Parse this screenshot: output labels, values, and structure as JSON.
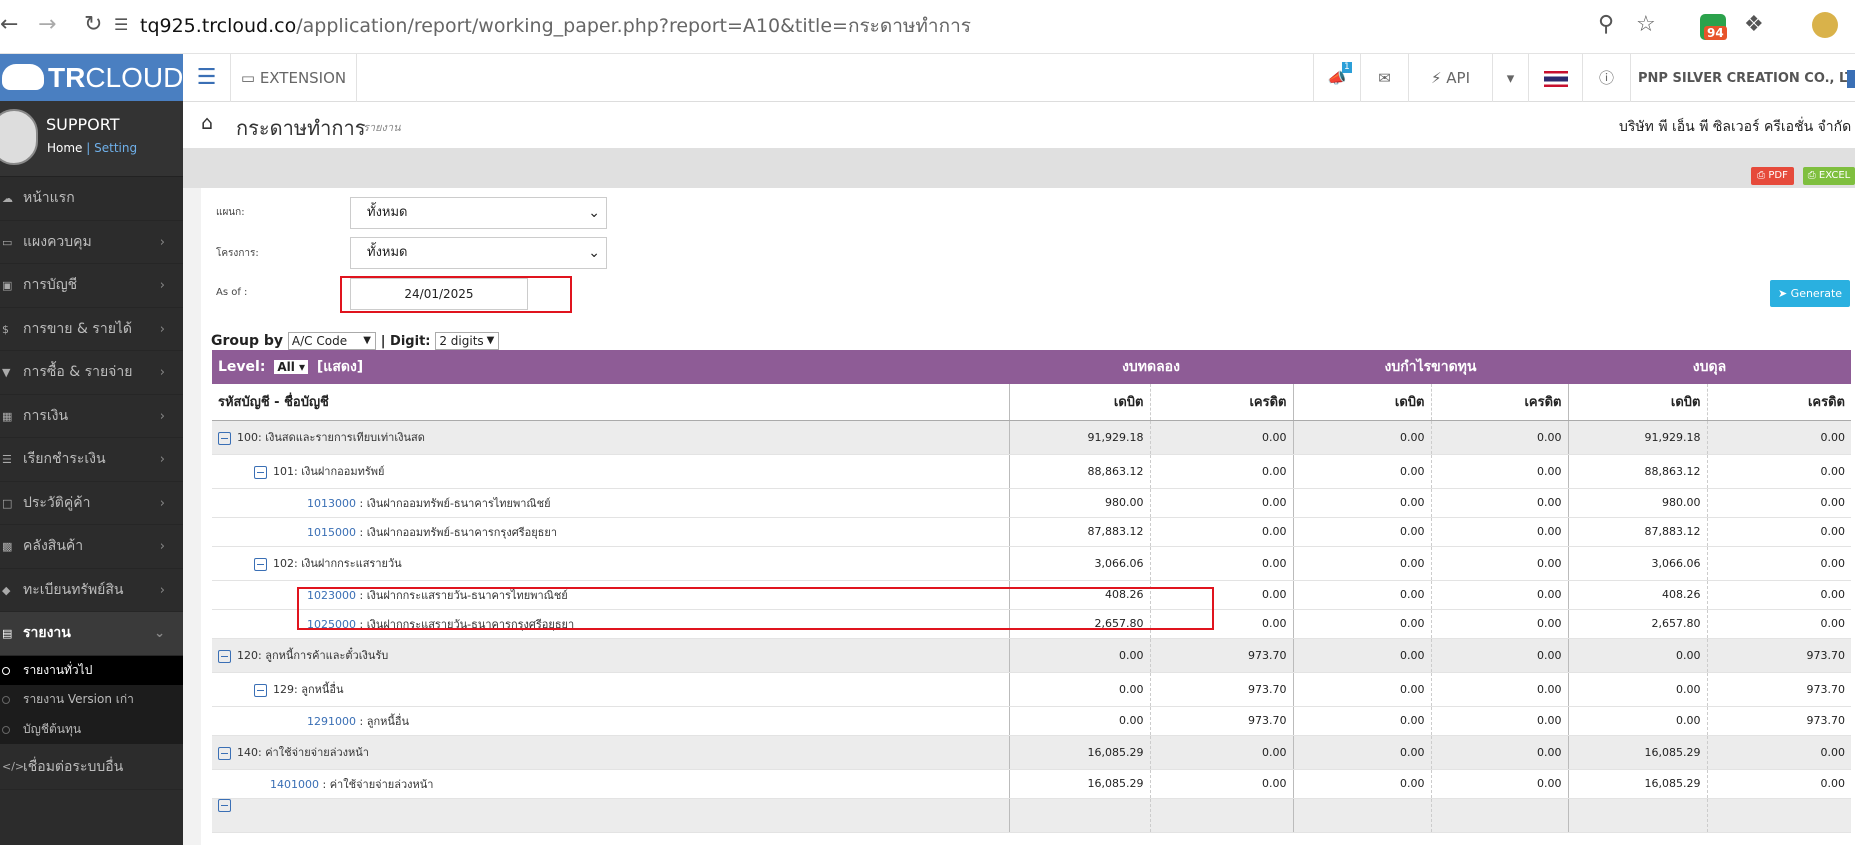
{
  "browser": {
    "url_domain": "tq925.trcloud.co",
    "url_path": "/application/report/working_paper.php?report=A10&title=กระดาษทำการ",
    "badge": "94"
  },
  "sidebar": {
    "logo_bold": "TR",
    "logo_light": "CLOUD",
    "user_name": "SUPPORT",
    "home_link": "Home",
    "setting_link": "Setting",
    "items": [
      {
        "label": "หน้าแรก"
      },
      {
        "label": "แผงควบคุม"
      },
      {
        "label": "การบัญชี"
      },
      {
        "label": "การขาย & รายได้"
      },
      {
        "label": "การซื้อ & รายจ่าย"
      },
      {
        "label": "การเงิน"
      },
      {
        "label": "เรียกชำระเงิน"
      },
      {
        "label": "ประวัติคู่ค้า"
      },
      {
        "label": "คลังสินค้า"
      },
      {
        "label": "ทะเบียนทรัพย์สิน"
      },
      {
        "label": "รายงาน"
      }
    ],
    "sub_items": [
      {
        "label": "รายงานทั่วไป"
      },
      {
        "label": "รายงาน Version เก่า"
      },
      {
        "label": "บัญชีต้นทุน"
      }
    ],
    "last_item": "เชื่อมต่อระบบอื่น"
  },
  "topbar": {
    "extension": "EXTENSION",
    "api": "API",
    "notif_count": "1",
    "company": "PNP SILVER CREATION CO., LTD"
  },
  "titlebar": {
    "title": "กระดาษทำการ",
    "subtitle": "รายงาน",
    "company_th": "บริษัท พี เอ็น พี ซิลเวอร์ ครีเอชั่น จำกัด"
  },
  "buttons": {
    "pdf": "PDF",
    "excel": "EXCEL",
    "generate": "Generate"
  },
  "form": {
    "department_label": "แผนก:",
    "department_value": "ทั้งหมด",
    "project_label": "โครงการ:",
    "project_value": "ทั้งหมด",
    "asof_label": "As of :",
    "asof_value": "24/01/2025",
    "groupby_label": "Group by",
    "groupby_value": "A/C Code",
    "digit_label": "| Digit:",
    "digit_value": "2 digits"
  },
  "table": {
    "level_label": "Level:",
    "level_value": "All",
    "show_label": "[แสดง]",
    "group_headers": [
      "งบทดลอง",
      "งบกำไรขาดทุน",
      "งบดุล"
    ],
    "account_header": "รหัสบัญชี - ชื่อบัญชี",
    "col_headers": [
      "เดบิต",
      "เครดิต",
      "เดบิต",
      "เครดิต",
      "เดบิต",
      "เครดิต"
    ],
    "rows": [
      {
        "level": 0,
        "code": "",
        "name": "100: เงินสดและรายการเทียบเท่าเงินสด",
        "v": [
          "91,929.18",
          "0.00",
          "0.00",
          "0.00",
          "91,929.18",
          "0.00"
        ]
      },
      {
        "level": 1,
        "code": "",
        "name": "101: เงินฝากออมทรัพย์",
        "v": [
          "88,863.12",
          "0.00",
          "0.00",
          "0.00",
          "88,863.12",
          "0.00"
        ]
      },
      {
        "level": 2,
        "code": "1013000",
        "name": " : เงินฝากออมทรัพย์-ธนาคารไทยพาณิชย์",
        "v": [
          "980.00",
          "0.00",
          "0.00",
          "0.00",
          "980.00",
          "0.00"
        ]
      },
      {
        "level": 2,
        "code": "1015000",
        "name": " : เงินฝากออมทรัพย์-ธนาคารกรุงศรีอยุธยา",
        "v": [
          "87,883.12",
          "0.00",
          "0.00",
          "0.00",
          "87,883.12",
          "0.00"
        ]
      },
      {
        "level": 1,
        "code": "",
        "name": "102: เงินฝากกระแสรายวัน",
        "v": [
          "3,066.06",
          "0.00",
          "0.00",
          "0.00",
          "3,066.06",
          "0.00"
        ]
      },
      {
        "level": 2,
        "code": "1023000",
        "name": " : เงินฝากกระแสรายวัน-ธนาคารไทยพาณิชย์",
        "v": [
          "408.26",
          "0.00",
          "0.00",
          "0.00",
          "408.26",
          "0.00"
        ]
      },
      {
        "level": 2,
        "code": "1025000",
        "name": " : เงินฝากกระแสรายวัน-ธนาคารกรุงศรีอยุธยา",
        "v": [
          "2,657.80",
          "0.00",
          "0.00",
          "0.00",
          "2,657.80",
          "0.00"
        ]
      },
      {
        "level": 0,
        "code": "",
        "name": "120: ลูกหนี้การค้าและตั๋วเงินรับ",
        "v": [
          "0.00",
          "973.70",
          "0.00",
          "0.00",
          "0.00",
          "973.70"
        ]
      },
      {
        "level": 1,
        "code": "",
        "name": "129: ลูกหนี้อื่น",
        "v": [
          "0.00",
          "973.70",
          "0.00",
          "0.00",
          "0.00",
          "973.70"
        ]
      },
      {
        "level": 2,
        "code": "1291000",
        "name": " : ลูกหนี้อื่น",
        "v": [
          "0.00",
          "973.70",
          "0.00",
          "0.00",
          "0.00",
          "973.70"
        ]
      },
      {
        "level": 0,
        "code": "",
        "name": "140: ค่าใช้จ่ายจ่ายล่วงหน้า",
        "v": [
          "16,085.29",
          "0.00",
          "0.00",
          "0.00",
          "16,085.29",
          "0.00"
        ]
      },
      {
        "level": 3,
        "code": "1401000",
        "name": " : ค่าใช้จ่ายจ่ายล่วงหน้า",
        "v": [
          "16,085.29",
          "0.00",
          "0.00",
          "0.00",
          "16,085.29",
          "0.00"
        ]
      }
    ]
  }
}
